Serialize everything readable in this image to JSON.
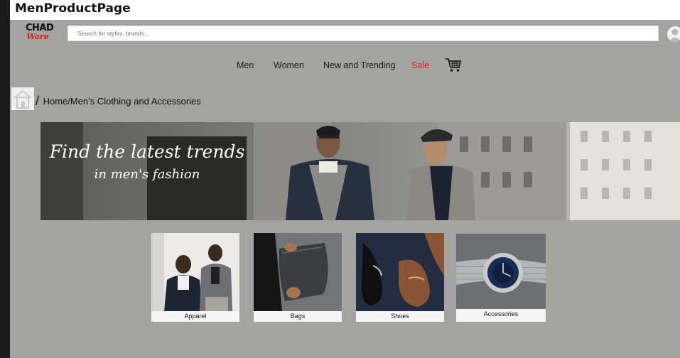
{
  "window": {
    "title": "MenProductPage"
  },
  "header": {
    "logo_top": "CHAD",
    "logo_bottom": "Ware",
    "search_placeholder": "Search for styles, brands..."
  },
  "nav": {
    "items": [
      "Men",
      "Women",
      "New and Trending",
      "Sale"
    ],
    "sale_color": "#e0241b",
    "cart_icon": "shopping-cart-icon"
  },
  "breadcrumb": {
    "separator": "/",
    "path": "Home/Men's Clothing and Accessories",
    "home_icon": "home-icon"
  },
  "banner": {
    "line1": "Find the latest trends",
    "line2": "in men's fashion"
  },
  "categories": [
    {
      "label": "Apparel"
    },
    {
      "label": "Bags"
    },
    {
      "label": "Shoes"
    },
    {
      "label": "Accessories"
    }
  ],
  "colors": {
    "page_background": "#a3a3a1",
    "sale": "#e0241b",
    "logo_accent": "#d21a1a"
  }
}
